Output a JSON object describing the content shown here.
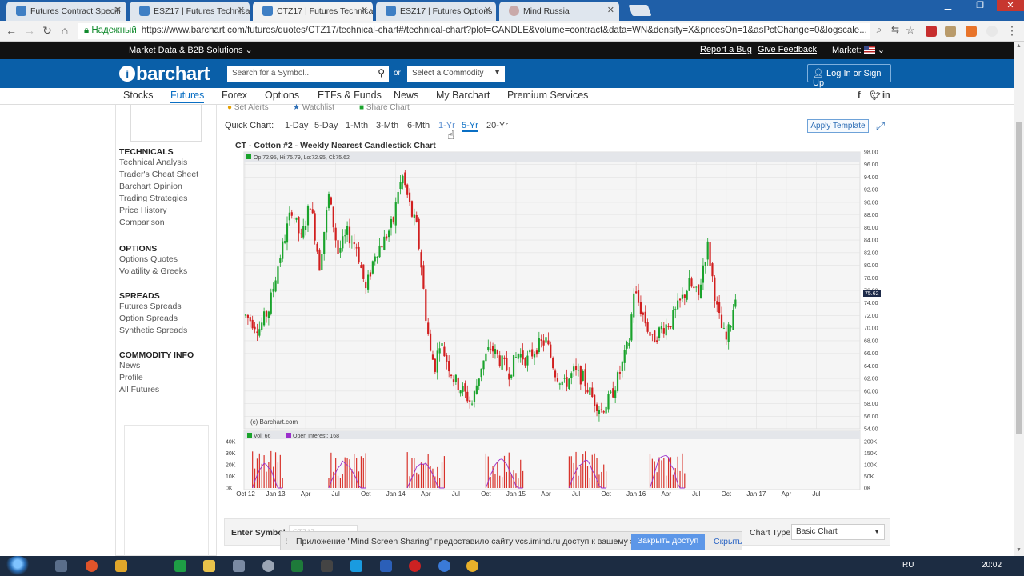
{
  "browser": {
    "tabs": [
      {
        "label": "Futures Contract Specifi",
        "active": false
      },
      {
        "label": "ESZ17 | Futures Technica",
        "active": false
      },
      {
        "label": "CTZ17 | Futures Technica",
        "active": true
      },
      {
        "label": "ESZ17 | Futures Options",
        "active": false
      },
      {
        "label": "Mind Russia",
        "active": false
      }
    ],
    "secure_label": "Надежный",
    "url": "https://www.barchart.com/futures/quotes/CTZ17/technical-chart#/technical-chart?plot=CANDLE&volume=contract&data=WN&density=X&pricesOn=1&asPctChange=0&logscale..."
  },
  "site": {
    "brand_menu": "Market Data & B2B Solutions",
    "report_bug": "Report a Bug",
    "feedback": "Give Feedback",
    "market_label": "Market:",
    "logo": "barchart",
    "search_placeholder": "Search for a Symbol...",
    "or": "or",
    "commodity_select": "Select a Commodity",
    "login": "Log In or Sign Up",
    "nav": [
      "Stocks",
      "Futures",
      "Forex",
      "Options",
      "ETFs & Funds",
      "News",
      "My Barchart",
      "Premium Services"
    ],
    "nav_active": "Futures",
    "partial_links": [
      "Set Alerts",
      "Watchlist",
      "Share Chart"
    ]
  },
  "sidebar": {
    "sections": [
      {
        "title": "TECHNICALS",
        "items": [
          "Technical Analysis",
          "Trader's Cheat Sheet",
          "Barchart Opinion",
          "Trading Strategies",
          "Price History",
          "Comparison"
        ]
      },
      {
        "title": "OPTIONS",
        "items": [
          "Options Quotes",
          "Volatility & Greeks"
        ]
      },
      {
        "title": "SPREADS",
        "items": [
          "Futures Spreads",
          "Option Spreads",
          "Synthetic Spreads"
        ]
      },
      {
        "title": "COMMODITY INFO",
        "items": [
          "News",
          "Profile",
          "All Futures"
        ]
      }
    ]
  },
  "quick_chart": {
    "label": "Quick Chart:",
    "ranges": [
      "1-Day",
      "5-Day",
      "1-Mth",
      "3-Mth",
      "6-Mth",
      "1-Yr",
      "5-Yr",
      "20-Yr"
    ],
    "active": "5-Yr",
    "apply_template": "Apply Template"
  },
  "chart_data": {
    "type": "candlestick",
    "title": "CT - Cotton #2 - Weekly Nearest Candlestick Chart",
    "ohlc_label": "Op:72.95, Hi:75.79, Lo:72.95, Cl:75.62",
    "last_price": "75.62",
    "watermark": "(c) Barchart.com",
    "ylim": [
      54,
      98
    ],
    "y_ticks": [
      "98.00",
      "96.00",
      "94.00",
      "92.00",
      "90.00",
      "88.00",
      "86.00",
      "84.00",
      "82.00",
      "80.00",
      "78.00",
      "76.00",
      "74.00",
      "72.00",
      "70.00",
      "68.00",
      "66.00",
      "64.00",
      "62.00",
      "60.00",
      "58.00",
      "56.00",
      "54.00"
    ],
    "x_labels": [
      "Oct 12",
      "Jan 13",
      "Apr",
      "Jul",
      "Oct",
      "Jan 14",
      "Apr",
      "Jul",
      "Oct",
      "Jan 15",
      "Apr",
      "Jul",
      "Oct",
      "Jan 16",
      "Apr",
      "Jul",
      "Oct",
      "Jan 17",
      "Apr",
      "Jul"
    ],
    "x_label_weeks": [
      0,
      13,
      26,
      39,
      52,
      65,
      78,
      91,
      104,
      117,
      130,
      143,
      156,
      169,
      182,
      195,
      208,
      221,
      234,
      247
    ],
    "close_path": [
      [
        0,
        72
      ],
      [
        6,
        70
      ],
      [
        10,
        73
      ],
      [
        14,
        80
      ],
      [
        18,
        86
      ],
      [
        20,
        89
      ],
      [
        24,
        84
      ],
      [
        28,
        90
      ],
      [
        32,
        80
      ],
      [
        36,
        91
      ],
      [
        40,
        82
      ],
      [
        44,
        85
      ],
      [
        48,
        83
      ],
      [
        52,
        76
      ],
      [
        56,
        82
      ],
      [
        60,
        84
      ],
      [
        64,
        87
      ],
      [
        66,
        92
      ],
      [
        68,
        94
      ],
      [
        72,
        88
      ],
      [
        74,
        86
      ],
      [
        76,
        80
      ],
      [
        78,
        72
      ],
      [
        80,
        66
      ],
      [
        82,
        64
      ],
      [
        84,
        68
      ],
      [
        86,
        66
      ],
      [
        90,
        62
      ],
      [
        94,
        60
      ],
      [
        98,
        58
      ],
      [
        102,
        64
      ],
      [
        106,
        67
      ],
      [
        110,
        65
      ],
      [
        114,
        63
      ],
      [
        118,
        66
      ],
      [
        122,
        65
      ],
      [
        126,
        67
      ],
      [
        130,
        68
      ],
      [
        134,
        63
      ],
      [
        138,
        61
      ],
      [
        142,
        63
      ],
      [
        146,
        62
      ],
      [
        150,
        59
      ],
      [
        154,
        57
      ],
      [
        158,
        59
      ],
      [
        162,
        63
      ],
      [
        166,
        68
      ],
      [
        168,
        76
      ],
      [
        172,
        72
      ],
      [
        176,
        68
      ],
      [
        180,
        70
      ],
      [
        184,
        71
      ],
      [
        188,
        74
      ],
      [
        192,
        77
      ],
      [
        196,
        75
      ],
      [
        198,
        80
      ],
      [
        200,
        83
      ],
      [
        202,
        78
      ],
      [
        204,
        73
      ],
      [
        206,
        70
      ],
      [
        208,
        68
      ],
      [
        210,
        71
      ],
      [
        212,
        75.62
      ]
    ],
    "volume": {
      "label": "Vol: 66",
      "open_interest_label": "Open Interest: 168",
      "left_ticks": [
        "40K",
        "30K",
        "20K",
        "10K",
        "0K"
      ],
      "right_ticks": [
        "200K",
        "150K",
        "100K",
        "50K",
        "0K"
      ],
      "oi_clusters": [
        [
          3,
          16,
          110000
        ],
        [
          36,
          52,
          120000
        ],
        [
          70,
          86,
          115000
        ],
        [
          104,
          120,
          130000
        ],
        [
          140,
          156,
          125000
        ],
        [
          175,
          190,
          150000
        ]
      ],
      "max_volume": 40000,
      "max_oi": 200000
    }
  },
  "colors": {
    "up": "#1aa32c",
    "down": "#d11f1f",
    "volume": "#d8322a",
    "open_interest": "#9b2fcc",
    "accent": "#0a6fc4",
    "header_bg": "#0a5fa8"
  },
  "bottom": {
    "enter_symbol": "Enter Symbol",
    "symbol_value": "CTZ17",
    "chart_type_label": "Chart Type:",
    "chart_type_value": "Basic Chart"
  },
  "notice": {
    "text": "Приложение \"Mind Screen Sharing\" предоставило сайту vcs.imind.ru доступ к вашему экрану.",
    "close_access": "Закрыть доступ",
    "hide": "Скрыть"
  },
  "taskbar": {
    "lang": "RU",
    "time": "20:02"
  }
}
